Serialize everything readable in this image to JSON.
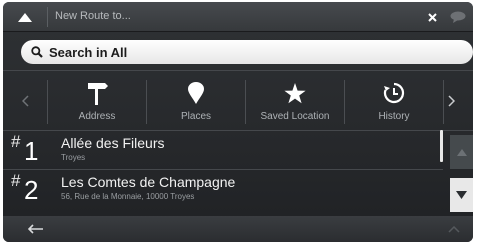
{
  "header": {
    "title": "New Route to..."
  },
  "icons": {
    "menu": "triangle-up-icon",
    "clear": "close-icon",
    "speech": "speech-bubble-icon",
    "search": "search-icon",
    "address": "signpost-icon",
    "places": "pin-icon",
    "saved": "star-icon",
    "history": "history-icon",
    "back": "arrow-left-icon"
  },
  "search": {
    "label": "Search in All"
  },
  "categories": [
    {
      "label": "Address"
    },
    {
      "label": "Places"
    },
    {
      "label": "Saved Location"
    },
    {
      "label": "History"
    }
  ],
  "results": [
    {
      "hash": "#",
      "number": "1",
      "name": "Allée des Fileurs",
      "detail": "Troyes"
    },
    {
      "hash": "#",
      "number": "2",
      "name": "Les Comtes de Champagne",
      "detail": "56, Rue de la Monnaie, 10000 Troyes"
    }
  ]
}
